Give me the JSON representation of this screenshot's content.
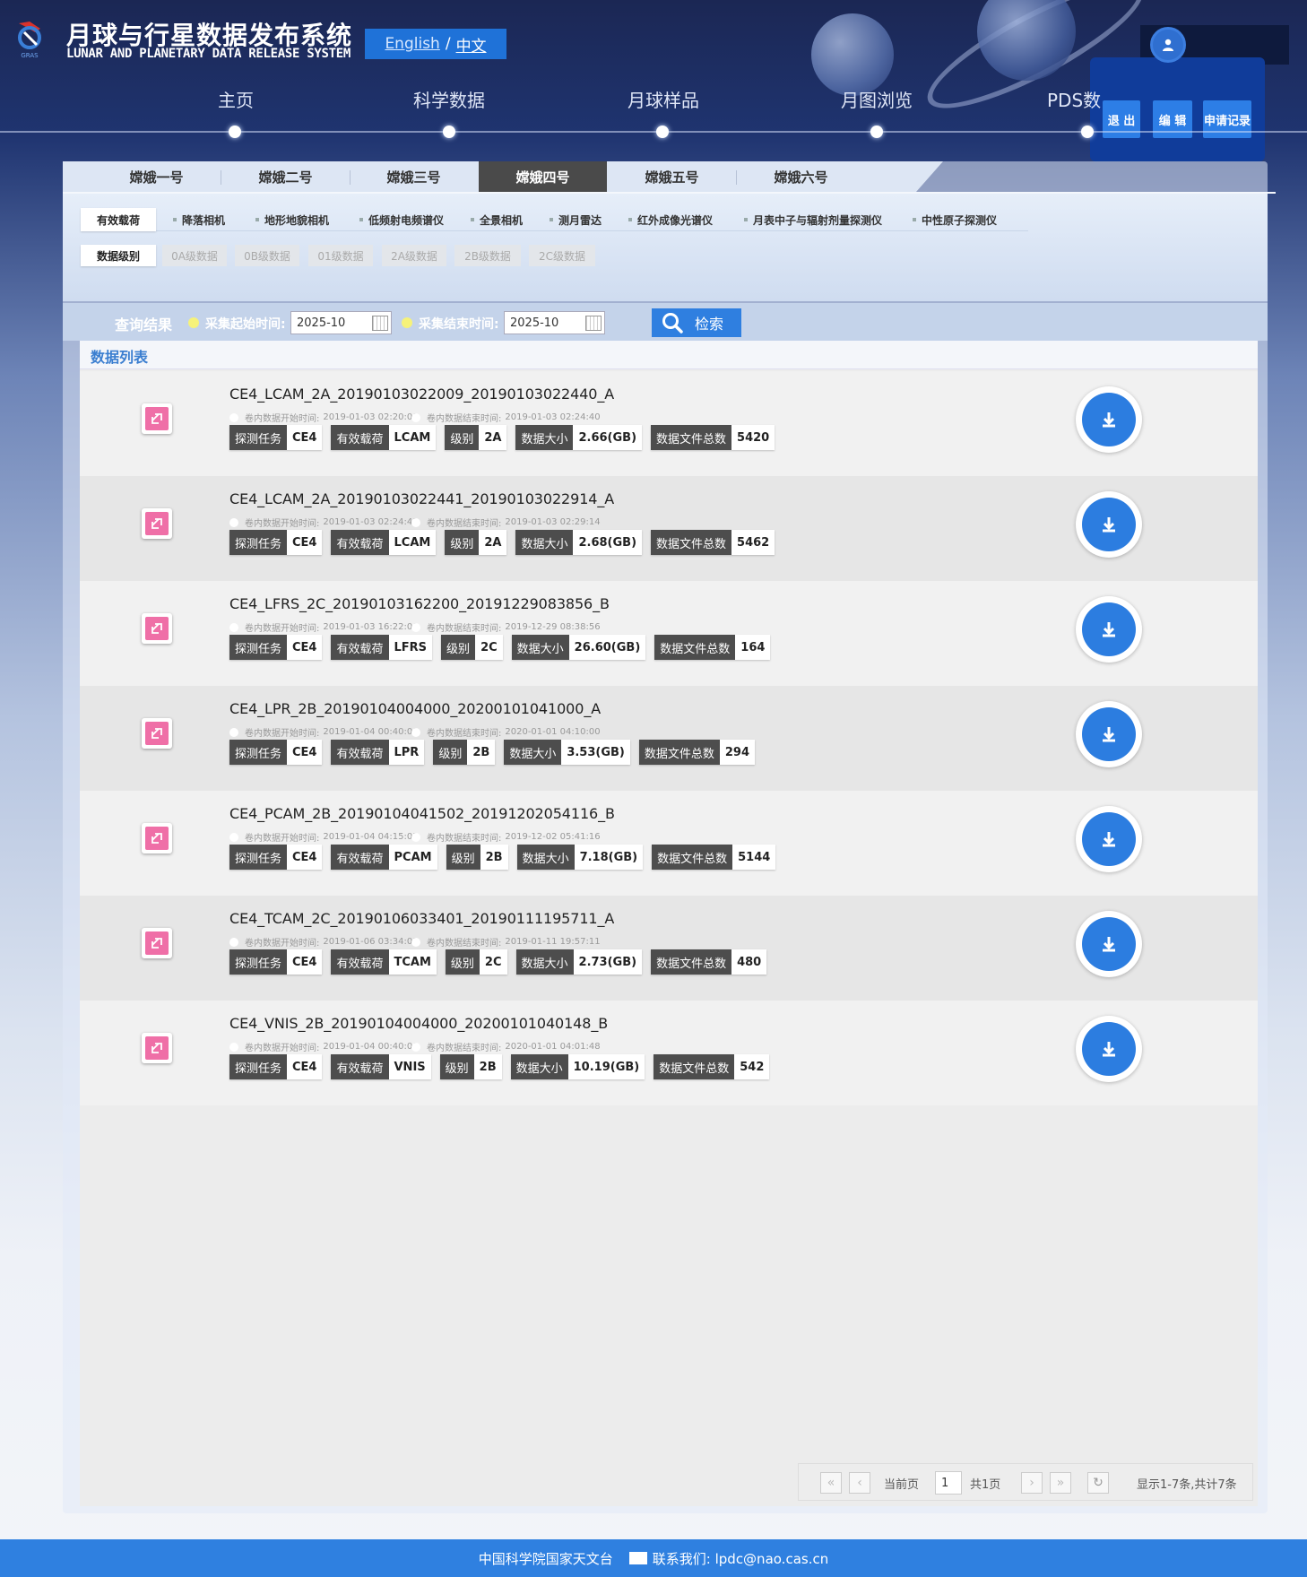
{
  "header": {
    "title_cn": "月球与行星数据发布系统",
    "title_en": "LUNAR AND PLANETARY DATA RELEASE SYSTEM",
    "lang_en": "English",
    "lang_sep": "/",
    "lang_cn": "中文",
    "logo_text": "GRAS"
  },
  "user_menu": {
    "logout": "退 出",
    "edit": "编 辑",
    "records": "申请记录"
  },
  "nav": [
    "主页",
    "科学数据",
    "月球样品",
    "月图浏览",
    "PDS数"
  ],
  "missions": [
    "嫦娥一号",
    "嫦娥二号",
    "嫦娥三号",
    "嫦娥四号",
    "嫦娥五号",
    "嫦娥六号"
  ],
  "active_mission": "嫦娥四号",
  "payloads": [
    "有效载荷",
    "降落相机",
    "地形地貌相机",
    "低频射电频谱仪",
    "全景相机",
    "测月雷达",
    "红外成像光谱仪",
    "月表中子与辐射剂量探测仪",
    "中性原子探测仪"
  ],
  "levels": [
    "数据级别",
    "0A级数据",
    "0B级数据",
    "01级数据",
    "2A级数据",
    "2B级数据",
    "2C级数据"
  ],
  "search": {
    "title": "查询结果",
    "start_label": "采集起始时间:",
    "start_value": "2025-10",
    "end_label": "采集结束时间:",
    "end_value": "2025-10",
    "button": "检索"
  },
  "list": {
    "title": "数据列表",
    "start_prefix": "卷内数据开始时间:",
    "end_prefix": "卷内数据结束时间:",
    "tag_keys": {
      "mission": "探测任务",
      "payload": "有效载荷",
      "level": "级别",
      "size": "数据大小",
      "count": "数据文件总数"
    },
    "rows": [
      {
        "title": "CE4_LCAM_2A_20190103022009_20190103022440_A",
        "start": "2019-01-03 02:20:09",
        "end": "2019-01-03 02:24:40",
        "mission": "CE4",
        "payload": "LCAM",
        "level": "2A",
        "size": "2.66(GB)",
        "count": "5420"
      },
      {
        "title": "CE4_LCAM_2A_20190103022441_20190103022914_A",
        "start": "2019-01-03 02:24:41",
        "end": "2019-01-03 02:29:14",
        "mission": "CE4",
        "payload": "LCAM",
        "level": "2A",
        "size": "2.68(GB)",
        "count": "5462"
      },
      {
        "title": "CE4_LFRS_2C_20190103162200_20191229083856_B",
        "start": "2019-01-03 16:22:00",
        "end": "2019-12-29 08:38:56",
        "mission": "CE4",
        "payload": "LFRS",
        "level": "2C",
        "size": "26.60(GB)",
        "count": "164"
      },
      {
        "title": "CE4_LPR_2B_20190104004000_20200101041000_A",
        "start": "2019-01-04 00:40:00",
        "end": "2020-01-01 04:10:00",
        "mission": "CE4",
        "payload": "LPR",
        "level": "2B",
        "size": "3.53(GB)",
        "count": "294"
      },
      {
        "title": "CE4_PCAM_2B_20190104041502_20191202054116_B",
        "start": "2019-01-04 04:15:02",
        "end": "2019-12-02 05:41:16",
        "mission": "CE4",
        "payload": "PCAM",
        "level": "2B",
        "size": "7.18(GB)",
        "count": "5144"
      },
      {
        "title": "CE4_TCAM_2C_20190106033401_20190111195711_A",
        "start": "2019-01-06 03:34:01",
        "end": "2019-01-11 19:57:11",
        "mission": "CE4",
        "payload": "TCAM",
        "level": "2C",
        "size": "2.73(GB)",
        "count": "480"
      },
      {
        "title": "CE4_VNIS_2B_20190104004000_20200101040148_B",
        "start": "2019-01-04 00:40:00",
        "end": "2020-01-01 04:01:48",
        "mission": "CE4",
        "payload": "VNIS",
        "level": "2B",
        "size": "10.19(GB)",
        "count": "542"
      }
    ]
  },
  "pager": {
    "current_label": "当前页",
    "current": "1",
    "total": "共1页",
    "summary": "显示1-7条,共计7条"
  },
  "footer": {
    "org": "中国科学院国家天文台",
    "contact": "联系我们: lpdc@nao.cas.cn"
  },
  "colors": {
    "accent": "#2f80e0",
    "tag_key": "#4d4d4d",
    "icon_pink": "#ef6fa7"
  }
}
